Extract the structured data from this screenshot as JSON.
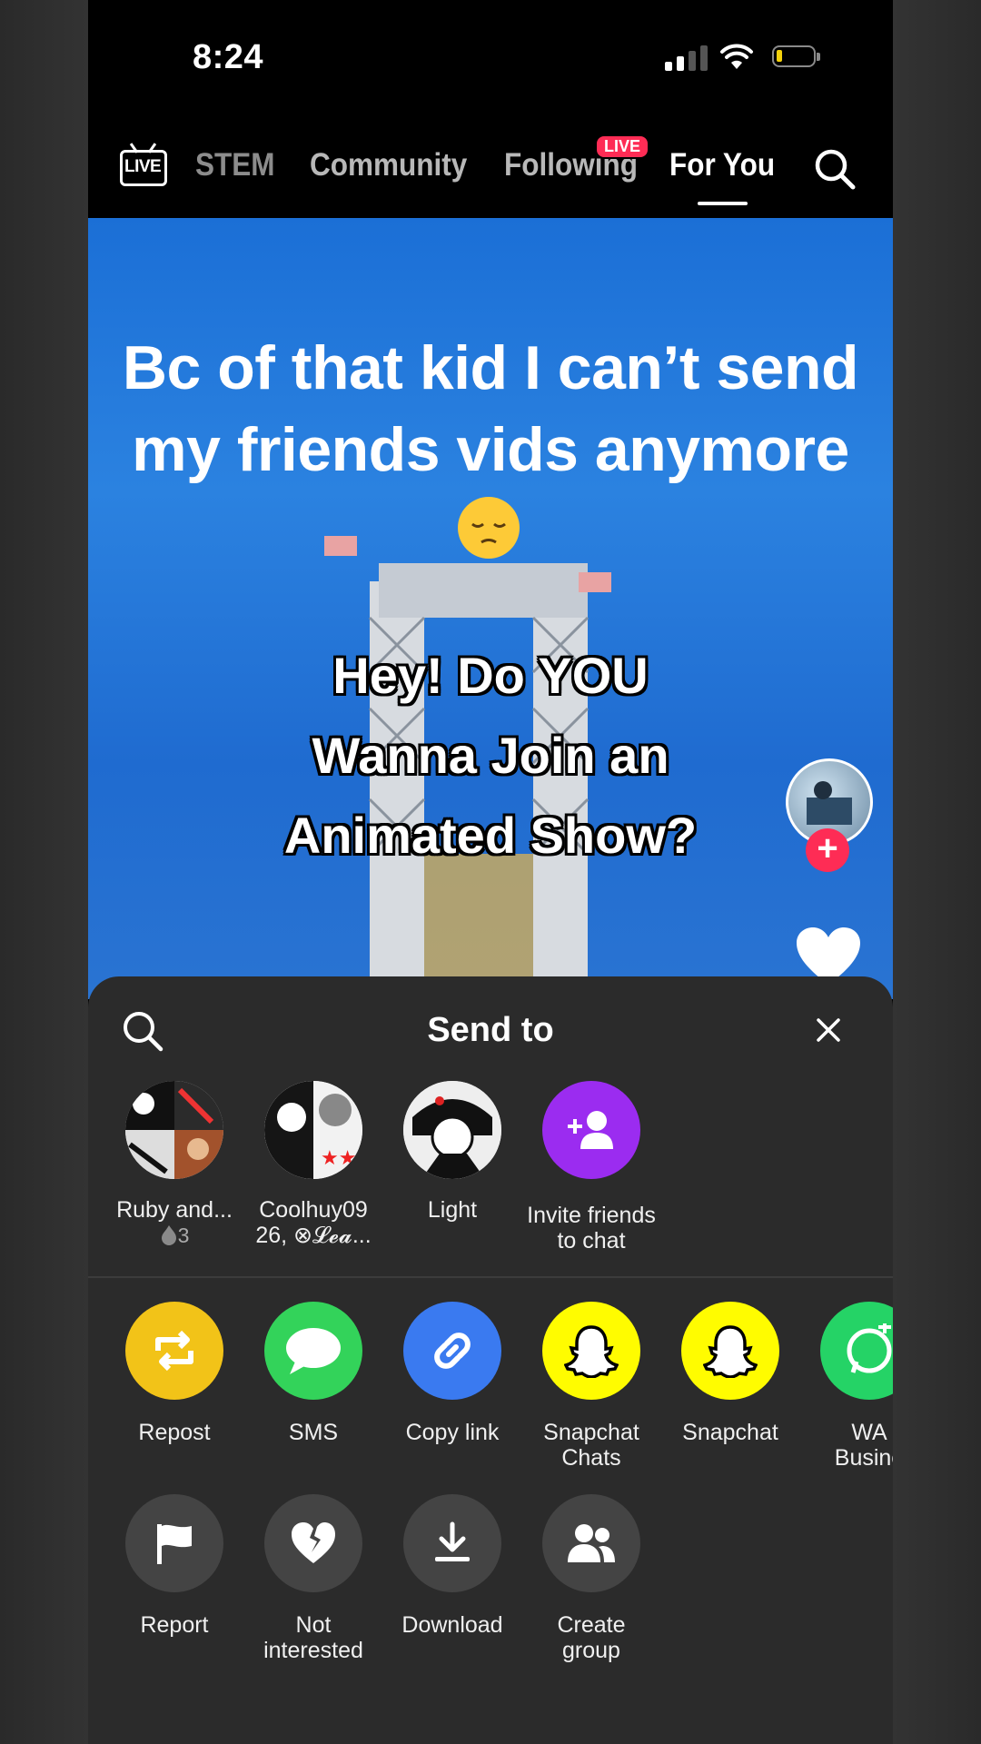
{
  "status": {
    "time": "8:24"
  },
  "nav": {
    "live_icon_text": "LIVE",
    "tabs": [
      "STEM",
      "Community",
      "Following",
      "For You"
    ],
    "live_badge": "LIVE",
    "active_tab": "For You"
  },
  "video": {
    "caption_line1": "Bc of that kid I can’t send",
    "caption_line2": "my friends vids anymore",
    "overlay_line1": "Hey! Do YOU",
    "overlay_line2": "Wanna Join an",
    "overlay_line3": "Animated Show?",
    "follow_symbol": "+"
  },
  "sheet": {
    "title": "Send to",
    "contacts": [
      {
        "name": "Ruby and...",
        "sub": "3"
      },
      {
        "name": "Coolhuy09",
        "sub": "26, ⊗𝓛𝓮𝓪..."
      },
      {
        "name": "Light",
        "sub": ""
      },
      {
        "name": "Invite friends",
        "sub": "to chat"
      }
    ],
    "share_row1": [
      {
        "label": "Repost",
        "color": "#f2c318"
      },
      {
        "label": "SMS",
        "color": "#33d35a"
      },
      {
        "label": "Copy link",
        "color": "#3a7af0"
      },
      {
        "label": "Snapchat\nChats",
        "color": "#fffc00"
      },
      {
        "label": "Snapchat",
        "color": "#fffc00"
      },
      {
        "label": "WA\nBusine",
        "color": "#25d366"
      }
    ],
    "share_row2": [
      {
        "label": "Report"
      },
      {
        "label": "Not\ninterested"
      },
      {
        "label": "Download"
      },
      {
        "label": "Create\ngroup"
      }
    ]
  }
}
